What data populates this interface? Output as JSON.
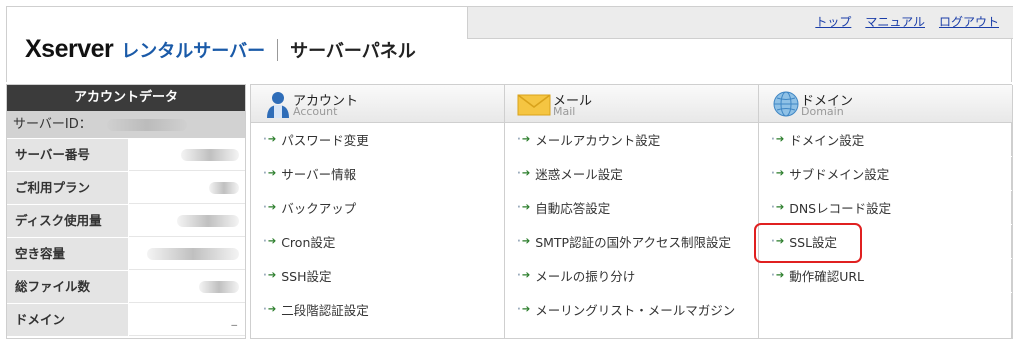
{
  "logo": {
    "brand": "Xserver",
    "sub": "レンタルサーバー",
    "panel": "サーバーパネル"
  },
  "topnav": {
    "links": [
      "トップ",
      "マニュアル",
      "ログアウト"
    ]
  },
  "account_data": {
    "header": "アカウントデータ",
    "server_id_label": "サーバーID：",
    "rows": [
      {
        "label": "サーバー番号"
      },
      {
        "label": "ご利用プラン"
      },
      {
        "label": "ディスク使用量"
      },
      {
        "label": "空き容量"
      },
      {
        "label": "総ファイル数"
      },
      {
        "label": "ドメイン",
        "mark": "_"
      }
    ]
  },
  "menu": {
    "account": {
      "title": "アカウント",
      "subtitle": "Account",
      "items": [
        "パスワード変更",
        "サーバー情報",
        "バックアップ",
        "Cron設定",
        "SSH設定",
        "二段階認証設定"
      ]
    },
    "mail": {
      "title": "メール",
      "subtitle": "Mail",
      "items": [
        "メールアカウント設定",
        "迷惑メール設定",
        "自動応答設定",
        "SMTP認証の国外アクセス制限設定",
        "メールの振り分け",
        "メーリングリスト・メールマガジン"
      ]
    },
    "domain": {
      "title": "ドメイン",
      "subtitle": "Domain",
      "items": [
        "ドメイン設定",
        "サブドメイン設定",
        "DNSレコード設定",
        "SSL設定",
        "動作確認URL"
      ]
    }
  },
  "colors": {
    "brand_blue": "#1a5aa8",
    "link": "#1a3da8",
    "highlight": "#e02020",
    "arrow": "#2a7d2a"
  }
}
